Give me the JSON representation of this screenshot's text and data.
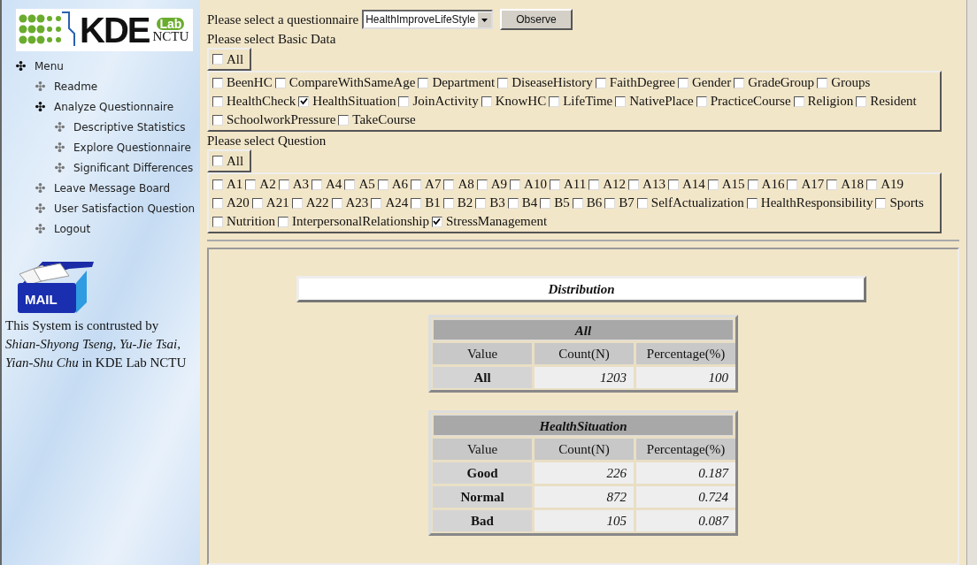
{
  "logo": {
    "name": "KDE",
    "lab": "Lab",
    "org": "NCTU"
  },
  "menu": [
    {
      "label": "Menu",
      "expanded": true,
      "children": [
        {
          "label": "Readme",
          "expanded": false
        },
        {
          "label": "Analyze Questionnaire",
          "expanded": true,
          "children": [
            {
              "label": "Descriptive Statistics",
              "expanded": false
            },
            {
              "label": "Explore Questionnaire",
              "expanded": false
            },
            {
              "label": "Significant Differences",
              "expanded": false
            }
          ]
        },
        {
          "label": "Leave Message Board",
          "expanded": false
        },
        {
          "label": "User Satisfaction Question",
          "expanded": false
        },
        {
          "label": "Logout",
          "expanded": false
        }
      ]
    }
  ],
  "mail_icon": {
    "label": "MAIL"
  },
  "credits": "This System is contrusted by *Shian-Shyong Tseng, Yu-Jie Tsai, Yian-Shu Chu* in KDE Lab NCTU",
  "questionnaire": {
    "label": "Please select a questionnaire",
    "value": "HealthImproveLifeStyle",
    "button": "Observe"
  },
  "basic_data": {
    "label": "Please select Basic Data",
    "all": {
      "label": "All",
      "checked": false
    },
    "items": [
      {
        "label": "BeenHC",
        "checked": false
      },
      {
        "label": "CompareWithSameAge",
        "checked": false
      },
      {
        "label": "Department",
        "checked": false
      },
      {
        "label": "DiseaseHistory",
        "checked": false
      },
      {
        "label": "FaithDegree",
        "checked": false
      },
      {
        "label": "Gender",
        "checked": false
      },
      {
        "label": "GradeGroup",
        "checked": false
      },
      {
        "label": "Groups",
        "checked": false
      },
      {
        "label": "HealthCheck",
        "checked": false
      },
      {
        "label": "HealthSituation",
        "checked": true
      },
      {
        "label": "JoinActivity",
        "checked": false
      },
      {
        "label": "KnowHC",
        "checked": false
      },
      {
        "label": "LifeTime",
        "checked": false
      },
      {
        "label": "NativePlace",
        "checked": false
      },
      {
        "label": "PracticeCourse",
        "checked": false
      },
      {
        "label": "Religion",
        "checked": false
      },
      {
        "label": "Resident",
        "checked": false
      },
      {
        "label": "SchoolworkPressure",
        "checked": false
      },
      {
        "label": "TakeCourse",
        "checked": false
      }
    ]
  },
  "question": {
    "label": "Please select Question",
    "all": {
      "label": "All",
      "checked": false
    },
    "items": [
      {
        "label": "A1",
        "checked": false
      },
      {
        "label": "A2",
        "checked": false
      },
      {
        "label": "A3",
        "checked": false
      },
      {
        "label": "A4",
        "checked": false
      },
      {
        "label": "A5",
        "checked": false
      },
      {
        "label": "A6",
        "checked": false
      },
      {
        "label": "A7",
        "checked": false
      },
      {
        "label": "A8",
        "checked": false
      },
      {
        "label": "A9",
        "checked": false
      },
      {
        "label": "A10",
        "checked": false
      },
      {
        "label": "A11",
        "checked": false
      },
      {
        "label": "A12",
        "checked": false
      },
      {
        "label": "A13",
        "checked": false
      },
      {
        "label": "A14",
        "checked": false
      },
      {
        "label": "A15",
        "checked": false
      },
      {
        "label": "A16",
        "checked": false
      },
      {
        "label": "A17",
        "checked": false
      },
      {
        "label": "A18",
        "checked": false
      },
      {
        "label": "A19",
        "checked": false
      },
      {
        "label": "A20",
        "checked": false
      },
      {
        "label": "A21",
        "checked": false
      },
      {
        "label": "A22",
        "checked": false
      },
      {
        "label": "A23",
        "checked": false
      },
      {
        "label": "A24",
        "checked": false
      },
      {
        "label": "B1",
        "checked": false
      },
      {
        "label": "B2",
        "checked": false
      },
      {
        "label": "B3",
        "checked": false
      },
      {
        "label": "B4",
        "checked": false
      },
      {
        "label": "B5",
        "checked": false
      },
      {
        "label": "B6",
        "checked": false
      },
      {
        "label": "B7",
        "checked": false
      },
      {
        "label": "SelfActualization",
        "checked": false
      },
      {
        "label": "HealthResponsibility",
        "checked": false
      },
      {
        "label": "Sports",
        "checked": false
      },
      {
        "label": "Nutrition",
        "checked": false
      },
      {
        "label": "InterpersonalRelationship",
        "checked": false
      },
      {
        "label": "StressManagement",
        "checked": true
      }
    ]
  },
  "results": {
    "title": "Distribution",
    "tables": [
      {
        "title": "All",
        "columns": [
          "Value",
          "Count(N)",
          "Percentage(%)"
        ],
        "rows": [
          {
            "value": "All",
            "count": "1203",
            "percentage": "100"
          }
        ]
      },
      {
        "title": "HealthSituation",
        "columns": [
          "Value",
          "Count(N)",
          "Percentage(%)"
        ],
        "rows": [
          {
            "value": "Good",
            "count": "226",
            "percentage": "0.187"
          },
          {
            "value": "Normal",
            "count": "872",
            "percentage": "0.724"
          },
          {
            "value": "Bad",
            "count": "105",
            "percentage": "0.087"
          }
        ]
      }
    ]
  }
}
